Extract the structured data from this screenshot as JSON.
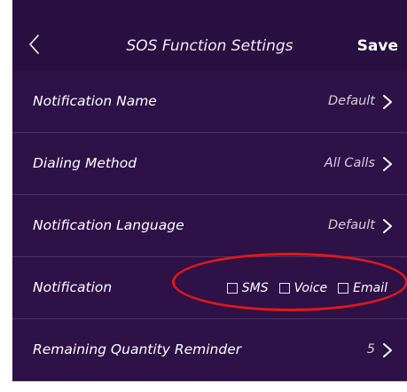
{
  "header": {
    "title": "SOS Function Settings",
    "save_label": "Save"
  },
  "rows": [
    {
      "label": "Notification Name",
      "value": "Default"
    },
    {
      "label": "Dialing Method",
      "value": "All Calls"
    },
    {
      "label": "Notification Language",
      "value": "Default"
    },
    {
      "label": "Notification",
      "options": [
        {
          "label": "SMS",
          "checked": false
        },
        {
          "label": "Voice",
          "checked": false
        },
        {
          "label": "Email",
          "checked": false
        }
      ]
    },
    {
      "label": "Remaining Quantity Reminder",
      "value": "5"
    }
  ],
  "colors": {
    "background": "#2e1147",
    "annotation": "#e01818"
  }
}
